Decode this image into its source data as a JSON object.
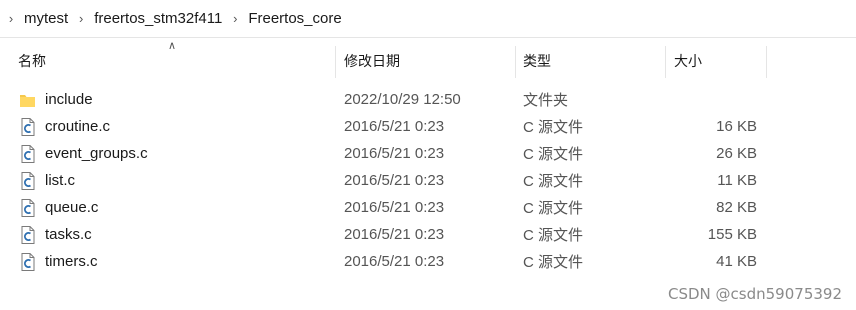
{
  "breadcrumb": [
    "mytest",
    "freertos_stm32f411",
    "Freertos_core"
  ],
  "columns": {
    "name": "名称",
    "date": "修改日期",
    "type": "类型",
    "size": "大小"
  },
  "files": [
    {
      "name": "include",
      "date": "2022/10/29 12:50",
      "type": "文件夹",
      "size": "",
      "icon": "folder-icon"
    },
    {
      "name": "croutine.c",
      "date": "2016/5/21 0:23",
      "type": "C 源文件",
      "size": "16 KB",
      "icon": "c-file-icon"
    },
    {
      "name": "event_groups.c",
      "date": "2016/5/21 0:23",
      "type": "C 源文件",
      "size": "26 KB",
      "icon": "c-file-icon"
    },
    {
      "name": "list.c",
      "date": "2016/5/21 0:23",
      "type": "C 源文件",
      "size": "11 KB",
      "icon": "c-file-icon"
    },
    {
      "name": "queue.c",
      "date": "2016/5/21 0:23",
      "type": "C 源文件",
      "size": "82 KB",
      "icon": "c-file-icon"
    },
    {
      "name": "tasks.c",
      "date": "2016/5/21 0:23",
      "type": "C 源文件",
      "size": "155 KB",
      "icon": "c-file-icon"
    },
    {
      "name": "timers.c",
      "date": "2016/5/21 0:23",
      "type": "C 源文件",
      "size": "41 KB",
      "icon": "c-file-icon"
    }
  ],
  "watermark": "CSDN @csdn59075392",
  "colors": {
    "folder": "#f5c84c",
    "c_icon": "#2e6fb0"
  }
}
